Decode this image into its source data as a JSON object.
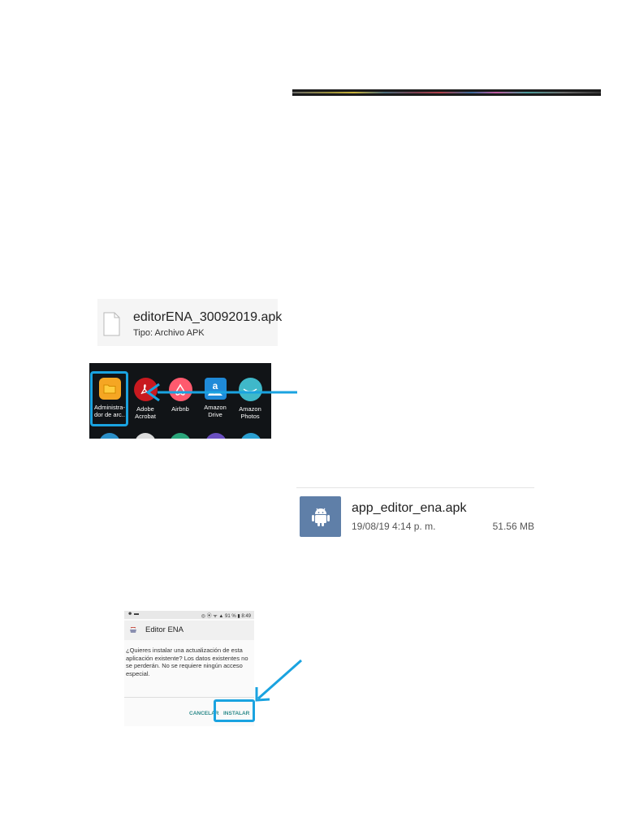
{
  "colors": {
    "accent": "#1aa3e0",
    "apk_tile": "#5f7fa8",
    "drawer_bg": "#111417",
    "dialog_button": "#2e8b8b"
  },
  "file_card": {
    "filename": "editorENA_30092019.apk",
    "type_label": "Tipo: Archivo APK",
    "icon": "document-icon"
  },
  "app_drawer": {
    "apps": [
      {
        "label": "Administra-\ndor de arc..",
        "icon": "folder-icon",
        "color": "#f5a623"
      },
      {
        "label": "Adobe\nAcrobat",
        "icon": "acrobat-icon",
        "color": "#c8191f"
      },
      {
        "label": "Airbnb",
        "icon": "airbnb-icon",
        "color": "#ff5a6e"
      },
      {
        "label": "Amazon\nDrive",
        "icon": "amazon-drive-icon",
        "color": "#1f8ad8"
      },
      {
        "label": "Amazon\nPhotos",
        "icon": "amazon-photos-icon",
        "color": "#3fb8c9"
      }
    ]
  },
  "apk_row": {
    "name": "app_editor_ena.apk",
    "date": "19/08/19 4:14 p. m.",
    "size": "51.56 MB",
    "icon": "android-icon"
  },
  "install_dialog": {
    "status_left": "☻ ▬",
    "status_right": "◎ ⦿ ᯤ ▲ 91 % ▮ 8:49",
    "title": "Editor ENA",
    "body": "¿Quieres instalar una actualización de esta aplicación existente? Los datos existentes no se perderán. No se requiere ningún acceso especial.",
    "cancel_label": "CANCELAR",
    "install_label": "INSTALAR"
  }
}
